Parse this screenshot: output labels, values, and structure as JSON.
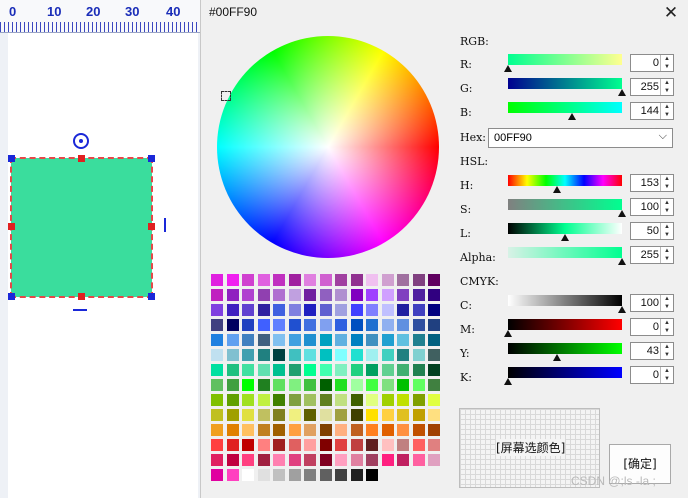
{
  "ruler": {
    "labels": [
      "0",
      "10",
      "20",
      "30",
      "40"
    ]
  },
  "dialog": {
    "title": "#00FF90",
    "close_glyph": "✕"
  },
  "rgb": {
    "header": "RGB:",
    "r": {
      "label": "R:",
      "value": "0"
    },
    "g": {
      "label": "G:",
      "value": "255"
    },
    "b": {
      "label": "B:",
      "value": "144"
    }
  },
  "hex": {
    "label": "Hex:",
    "value": "00FF90",
    "chevron": "⌵"
  },
  "hsl": {
    "header": "HSL:",
    "h": {
      "label": "H:",
      "value": "153"
    },
    "s": {
      "label": "S:",
      "value": "100"
    },
    "l": {
      "label": "L:",
      "value": "50"
    }
  },
  "alpha": {
    "label": "Alpha:",
    "value": "255"
  },
  "cmyk": {
    "header": "CMYK:",
    "c": {
      "label": "C:",
      "value": "100"
    },
    "m": {
      "label": "M:",
      "value": "0"
    },
    "y": {
      "label": "Y:",
      "value": "43"
    },
    "k": {
      "label": "K:",
      "value": "0"
    }
  },
  "screen_pick_label": "[屏幕选颜色]",
  "ok_label": "[确定]",
  "watermark": "CSDN @;ls -la ;",
  "selected_color": "#00FF90",
  "swatches": [
    "#e020e0",
    "#f020f0",
    "#d040d0",
    "#e060e0",
    "#c030c0",
    "#a020a0",
    "#e080e0",
    "#d060d0",
    "#a040a0",
    "#903090",
    "#f0c0f0",
    "#d0a0d0",
    "#a070a0",
    "#804080",
    "#600060",
    "#c020c0",
    "#9020c0",
    "#b040d0",
    "#9040b0",
    "#b070d0",
    "#c0a0e0",
    "#7020a0",
    "#9060c0",
    "#b090d0",
    "#8000c0",
    "#a040ff",
    "#d0a0ff",
    "#8040c0",
    "#5020a0",
    "#300080",
    "#8040e0",
    "#4020c0",
    "#6040d0",
    "#3020a0",
    "#4060e0",
    "#8080e0",
    "#2020c0",
    "#6060d0",
    "#a0a0e0",
    "#4040ff",
    "#8080ff",
    "#c0c0ff",
    "#2020a0",
    "#4040c0",
    "#000080",
    "#404080",
    "#000060",
    "#2040c0",
    "#4060ff",
    "#6080ff",
    "#2050d0",
    "#4070e0",
    "#80a0f0",
    "#3060e0",
    "#0050c0",
    "#2070d0",
    "#90b0f0",
    "#6090e0",
    "#3050a0",
    "#204080",
    "#2080e0",
    "#60a0f0",
    "#4080c0",
    "#406080",
    "#80c0f0",
    "#40a0e0",
    "#2090d0",
    "#00a0c0",
    "#60b0e0",
    "#0080c0",
    "#4090c0",
    "#20a0d0",
    "#60c0e0",
    "#208090",
    "#006080",
    "#c0e0f0",
    "#80c0d0",
    "#40a0b0",
    "#208080",
    "#004040",
    "#40c0c0",
    "#60e0e0",
    "#00c0c0",
    "#80ffff",
    "#20e0d0",
    "#a0f0f0",
    "#40d0c0",
    "#208080",
    "#80d0d0",
    "#406060",
    "#00e0a0",
    "#20c080",
    "#40e0a0",
    "#60e0b0",
    "#00c090",
    "#20a070",
    "#00ff90",
    "#40ffb0",
    "#80f0c0",
    "#20d080",
    "#00a060",
    "#60d090",
    "#40b070",
    "#208050",
    "#004020",
    "#60c060",
    "#40a040",
    "#00ff00",
    "#208020",
    "#60e060",
    "#80f080",
    "#40c040",
    "#006000",
    "#20e020",
    "#a0ffa0",
    "#40ff40",
    "#80e080",
    "#00c000",
    "#60ff60",
    "#408040",
    "#80c000",
    "#60a000",
    "#a0e020",
    "#c0f040",
    "#408000",
    "#80a040",
    "#a0c060",
    "#608020",
    "#c0e080",
    "#406000",
    "#e0ff80",
    "#a0d000",
    "#c0e000",
    "#80a000",
    "#e0ff40",
    "#c0c020",
    "#a0a000",
    "#e0e040",
    "#c0c060",
    "#808020",
    "#f0f080",
    "#606000",
    "#e0e0a0",
    "#a0a040",
    "#404000",
    "#ffe000",
    "#ffd040",
    "#e0c020",
    "#c0a000",
    "#ffe080",
    "#f0a020",
    "#e08000",
    "#ffc060",
    "#c08020",
    "#a06000",
    "#ffa040",
    "#e0a060",
    "#804000",
    "#ffb080",
    "#c06020",
    "#ff8020",
    "#e06000",
    "#ff9040",
    "#c05000",
    "#a04000",
    "#ff4040",
    "#e02020",
    "#c00000",
    "#ff8080",
    "#a02020",
    "#e06060",
    "#ffa0a0",
    "#800000",
    "#e04040",
    "#c04040",
    "#602020",
    "#ffc0c0",
    "#c08080",
    "#ff6060",
    "#e08080",
    "#e02060",
    "#c00040",
    "#ff4080",
    "#a02040",
    "#ff80b0",
    "#e04080",
    "#c04060",
    "#800020",
    "#ffa0c0",
    "#e080a0",
    "#a04060",
    "#ff2080",
    "#c02060",
    "#ff60a0",
    "#e0a0c0",
    "#e000a0",
    "#ff40c0",
    "#ffffff",
    "#e0e0e0",
    "#c0c0c0",
    "#a0a0a0",
    "#808080",
    "#606060",
    "#404040",
    "#202020",
    "#000000"
  ]
}
